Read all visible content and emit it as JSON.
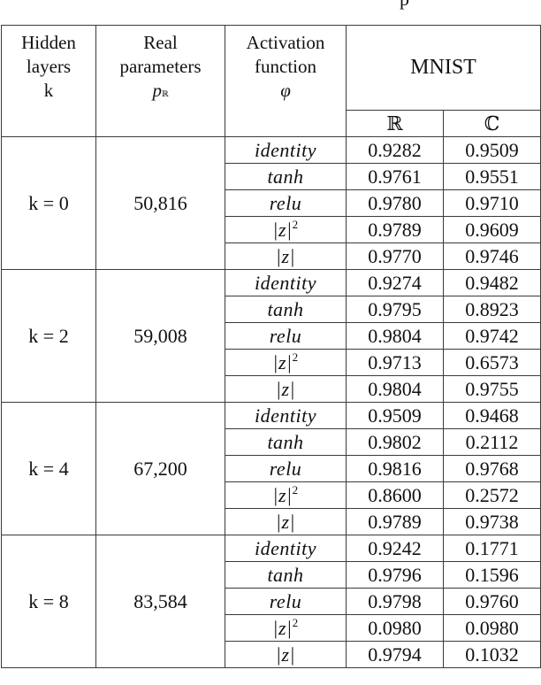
{
  "caption_fragment": "p",
  "table": {
    "headers": {
      "hidden_layers": [
        "Hidden",
        "layers",
        "k"
      ],
      "real_params": [
        "Real",
        "parameters",
        "p",
        "ℝ"
      ],
      "activation": [
        "Activation",
        "function",
        "φ"
      ],
      "dataset": "MNIST",
      "real_col": "ℝ",
      "complex_col": "ℂ"
    },
    "groups": [
      {
        "k": "k = 0",
        "params": "50,816",
        "rows": [
          {
            "act": "identity",
            "sup": "",
            "real": "0.9282",
            "complex": "0.9509"
          },
          {
            "act": "tanh",
            "sup": "",
            "real": "0.9761",
            "complex": "0.9551"
          },
          {
            "act": "relu",
            "sup": "",
            "real": "0.9780",
            "complex": "0.9710"
          },
          {
            "act": "|z|",
            "sup": "2",
            "real": "0.9789",
            "complex": "0.9609"
          },
          {
            "act": "|z|",
            "sup": "",
            "real": "0.9770",
            "complex": "0.9746"
          }
        ]
      },
      {
        "k": "k = 2",
        "params": "59,008",
        "rows": [
          {
            "act": "identity",
            "sup": "",
            "real": "0.9274",
            "complex": "0.9482"
          },
          {
            "act": "tanh",
            "sup": "",
            "real": "0.9795",
            "complex": "0.8923"
          },
          {
            "act": "relu",
            "sup": "",
            "real": "0.9804",
            "complex": "0.9742"
          },
          {
            "act": "|z|",
            "sup": "2",
            "real": "0.9713",
            "complex": "0.6573"
          },
          {
            "act": "|z|",
            "sup": "",
            "real": "0.9804",
            "complex": "0.9755"
          }
        ]
      },
      {
        "k": "k = 4",
        "params": "67,200",
        "rows": [
          {
            "act": "identity",
            "sup": "",
            "real": "0.9509",
            "complex": "0.9468"
          },
          {
            "act": "tanh",
            "sup": "",
            "real": "0.9802",
            "complex": "0.2112"
          },
          {
            "act": "relu",
            "sup": "",
            "real": "0.9816",
            "complex": "0.9768"
          },
          {
            "act": "|z|",
            "sup": "2",
            "real": "0.8600",
            "complex": "0.2572"
          },
          {
            "act": "|z|",
            "sup": "",
            "real": "0.9789",
            "complex": "0.9738"
          }
        ]
      },
      {
        "k": "k = 8",
        "params": "83,584",
        "rows": [
          {
            "act": "identity",
            "sup": "",
            "real": "0.9242",
            "complex": "0.1771"
          },
          {
            "act": "tanh",
            "sup": "",
            "real": "0.9796",
            "complex": "0.1596"
          },
          {
            "act": "relu",
            "sup": "",
            "real": "0.9798",
            "complex": "0.9760"
          },
          {
            "act": "|z|",
            "sup": "2",
            "real": "0.0980",
            "complex": "0.0980"
          },
          {
            "act": "|z|",
            "sup": "",
            "real": "0.9794",
            "complex": "0.1032"
          }
        ]
      }
    ]
  }
}
